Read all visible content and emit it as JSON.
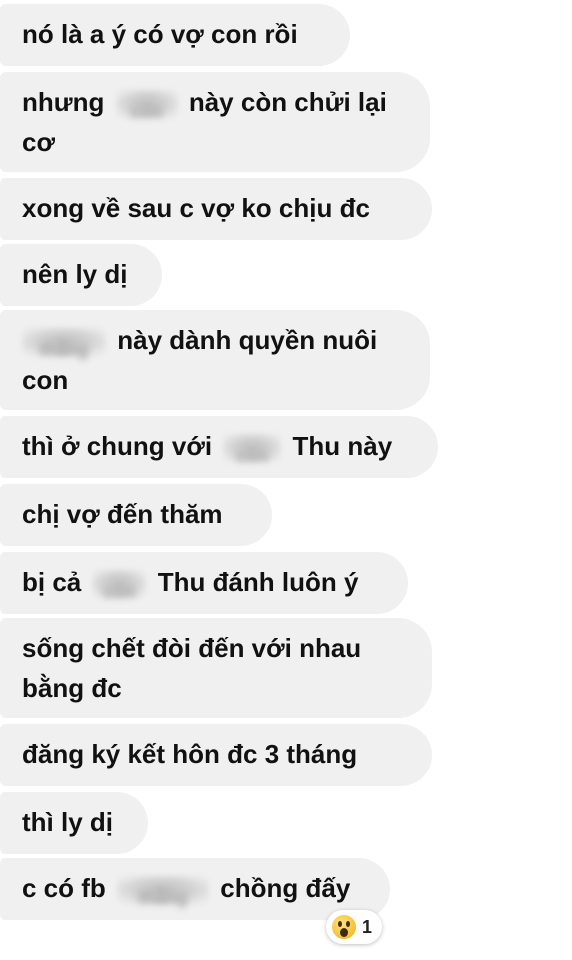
{
  "messages": [
    {
      "text": "nó là a ý có vợ con rồi"
    },
    {
      "line1_before": "nhưng",
      "line1_blur": "con",
      "line1_after": "này còn chửi lại",
      "line2": "cơ"
    },
    {
      "text": "xong về sau c vợ ko chịu đc"
    },
    {
      "text": "nên ly dị"
    },
    {
      "line1_blur": "thằng",
      "line1_after": "này dành quyền nuôi",
      "line2": "con"
    },
    {
      "before": "thì ở chung với",
      "blur": "con",
      "after": "Thu này"
    },
    {
      "text": "chị vợ đến thăm"
    },
    {
      "before": "bị cả",
      "blur": "con",
      "after": "Thu đánh luôn ý"
    },
    {
      "line1": "sống chết đòi đến với nhau",
      "line2": "bằng đc"
    },
    {
      "text": "đăng ký kết hôn đc 3 tháng"
    },
    {
      "text": "thì ly dị"
    },
    {
      "before": "c có fb",
      "blur": "thằng",
      "after": "chồng đấy"
    }
  ],
  "reaction": {
    "icon": "wow-emoji-icon",
    "count": "1"
  },
  "colors": {
    "bubble_bg": "#f0f0f0",
    "text": "#111111",
    "page_bg": "#ffffff"
  }
}
